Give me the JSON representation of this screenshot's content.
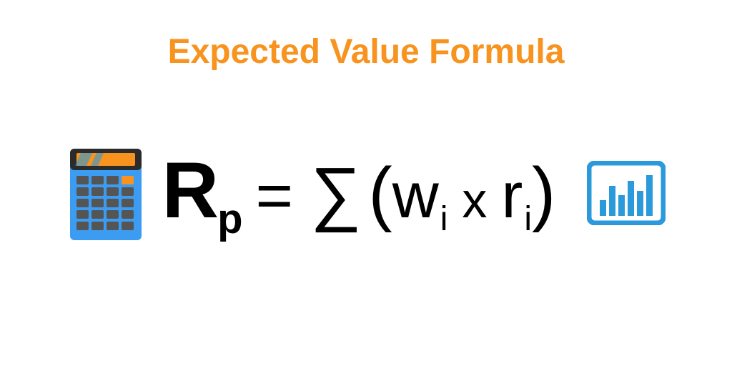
{
  "title": "Expected Value Formula",
  "formula": {
    "lhs_var": "R",
    "lhs_sub": "p",
    "equals": "=",
    "sigma": "∑",
    "open_paren": "(",
    "term1_var": "w",
    "term1_sub": "i",
    "times": "x",
    "term2_var": "r",
    "term2_sub": "i",
    "close_paren": ")"
  },
  "colors": {
    "title": "#f7931e",
    "calc_body": "#3b9cf1",
    "calc_dark": "#2b2b2b",
    "calc_orange": "#f7931e",
    "chart_blue": "#2b9adb"
  }
}
